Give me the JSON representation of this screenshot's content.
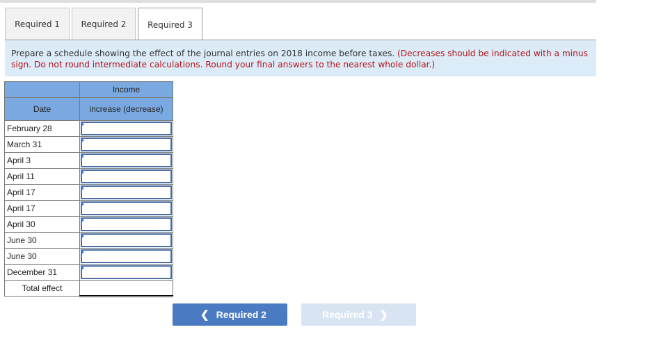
{
  "tabs": [
    {
      "label": "Required 1",
      "active": false
    },
    {
      "label": "Required 2",
      "active": false
    },
    {
      "label": "Required 3",
      "active": true
    }
  ],
  "instructions": {
    "main": "Prepare a schedule showing the effect of the journal entries on 2018 income before taxes.",
    "note": "(Decreases should be indicated with a minus sign. Do not round intermediate calculations. Round your final answers to the nearest whole dollar.)"
  },
  "table": {
    "header_top": "Income",
    "header_date": "Date",
    "header_value": "increase (decrease)",
    "rows": [
      {
        "date": "February 28",
        "value": ""
      },
      {
        "date": "March 31",
        "value": ""
      },
      {
        "date": "April 3",
        "value": ""
      },
      {
        "date": "April 11",
        "value": ""
      },
      {
        "date": "April 17",
        "value": ""
      },
      {
        "date": "April 17",
        "value": ""
      },
      {
        "date": "April 30",
        "value": ""
      },
      {
        "date": "June 30",
        "value": ""
      },
      {
        "date": "June 30",
        "value": ""
      },
      {
        "date": "December 31",
        "value": ""
      }
    ],
    "total_label": "Total effect",
    "total_value": ""
  },
  "nav": {
    "prev_label": "Required 2",
    "next_label": "Required 3",
    "prev_icon": "chevron-left-icon",
    "next_icon": "chevron-right-icon"
  }
}
